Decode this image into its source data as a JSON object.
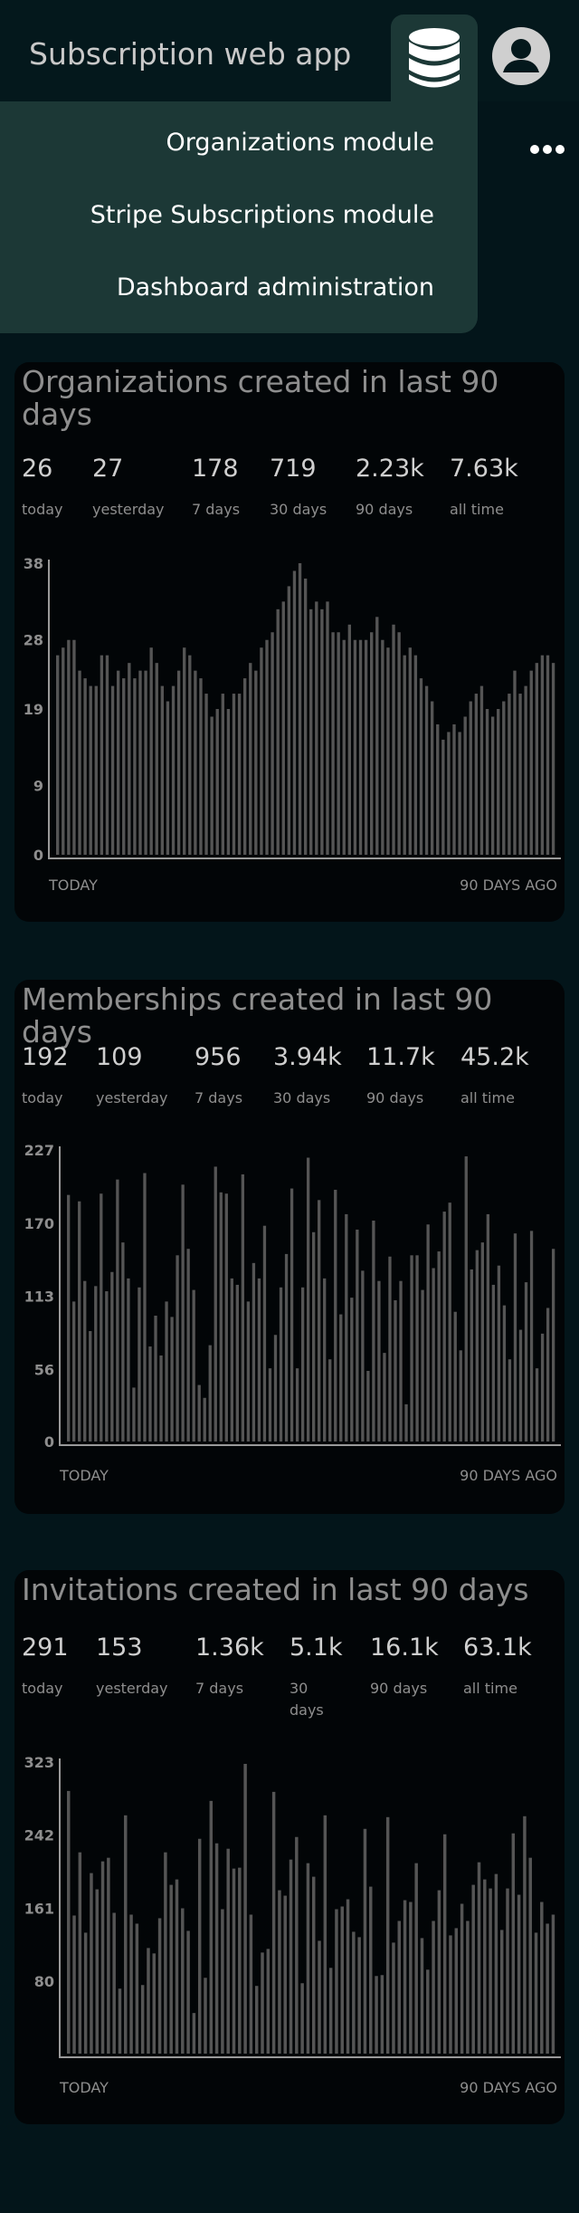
{
  "app": {
    "title": "Subscription web app",
    "accent_panel_color": "#1c3836",
    "background_color": "#03151a",
    "bar_color": "#555555",
    "icons": [
      "database-icon",
      "user-avatar-icon",
      "more-horizontal-icon"
    ]
  },
  "menu": {
    "items": [
      {
        "label": "Organizations module"
      },
      {
        "label": "Stripe Subscriptions module"
      },
      {
        "label": "Dashboard administration"
      }
    ]
  },
  "cards": [
    {
      "title": "Organizations created in last 90 days",
      "stats": [
        {
          "value": "26",
          "label": "today"
        },
        {
          "value": "27",
          "label": "yesterday"
        },
        {
          "value": "178",
          "label": "7 days"
        },
        {
          "value": "719",
          "label": "30 days"
        },
        {
          "value": "2.23k",
          "label": "90 days"
        },
        {
          "value": "7.63k",
          "label": "all time"
        }
      ],
      "x_left_label": "TODAY",
      "x_right_label": "90 DAYS AGO"
    },
    {
      "title": "Memberships created in last 90 days",
      "stats": [
        {
          "value": "192",
          "label": "today"
        },
        {
          "value": "109",
          "label": "yesterday"
        },
        {
          "value": "956",
          "label": "7 days"
        },
        {
          "value": "3.94k",
          "label": "30 days"
        },
        {
          "value": "11.7k",
          "label": "90 days"
        },
        {
          "value": "45.2k",
          "label": "all time"
        }
      ],
      "x_left_label": "TODAY",
      "x_right_label": "90 DAYS AGO"
    },
    {
      "title": "Invitations created in last 90 days",
      "stats": [
        {
          "value": "291",
          "label": "today"
        },
        {
          "value": "153",
          "label": "yesterday"
        },
        {
          "value": "1.36k",
          "label": "7 days"
        },
        {
          "value": "5.1k",
          "label": "30 days"
        },
        {
          "value": "16.1k",
          "label": "90 days"
        },
        {
          "value": "63.1k",
          "label": "all time"
        }
      ],
      "x_left_label": "TODAY",
      "x_right_label": "90 DAYS AGO"
    }
  ],
  "chart_data": [
    {
      "type": "bar",
      "ticks": [
        "38",
        "28",
        "19",
        "9",
        "0"
      ],
      "ylim": [
        0,
        38
      ],
      "grid": false,
      "values": [
        26,
        27,
        28,
        28,
        24,
        23,
        22,
        22,
        26,
        26,
        22,
        24,
        23,
        25,
        23,
        24,
        24,
        27,
        25,
        22,
        20,
        22,
        24,
        27,
        26,
        24,
        23,
        21,
        18,
        19,
        21,
        19,
        21,
        21,
        23,
        25,
        24,
        27,
        28,
        29,
        32,
        33,
        35,
        37,
        38,
        36,
        32,
        33,
        32,
        33,
        29,
        29,
        28,
        30,
        28,
        28,
        28,
        29,
        31,
        28,
        27,
        30,
        29,
        26,
        27,
        26,
        23,
        22,
        20,
        17,
        15,
        16,
        17,
        16,
        18,
        20,
        21,
        22,
        19,
        18,
        19,
        20,
        21,
        24,
        21,
        22,
        24,
        25,
        26,
        26,
        25
      ]
    },
    {
      "type": "bar",
      "ticks": [
        "227",
        "170",
        "113",
        "56",
        "0"
      ],
      "ylim": [
        0,
        227
      ],
      "grid": false,
      "values": [
        192,
        109,
        187,
        125,
        86,
        121,
        193,
        117,
        132,
        204,
        155,
        127,
        42,
        120,
        209,
        74,
        98,
        67,
        109,
        97,
        145,
        200,
        150,
        118,
        44,
        34,
        75,
        214,
        194,
        193,
        127,
        122,
        208,
        109,
        139,
        127,
        168,
        57,
        83,
        120,
        146,
        197,
        57,
        120,
        221,
        163,
        188,
        127,
        64,
        196,
        99,
        177,
        112,
        165,
        133,
        55,
        172,
        125,
        69,
        144,
        110,
        125,
        29,
        145,
        145,
        118,
        169,
        135,
        148,
        179,
        186,
        101,
        71,
        222,
        134,
        149,
        155,
        177,
        122,
        137,
        106,
        64,
        162,
        87,
        124,
        164,
        57,
        84,
        104,
        150
      ]
    },
    {
      "type": "bar",
      "ticks": [
        "323",
        "242",
        "161",
        "80"
      ],
      "ylim": [
        0,
        323
      ],
      "grid": false,
      "values": [
        291,
        153,
        223,
        134,
        200,
        182,
        213,
        217,
        156,
        72,
        264,
        154,
        144,
        76,
        117,
        111,
        150,
        223,
        187,
        193,
        161,
        136,
        45,
        238,
        84,
        280,
        233,
        160,
        227,
        205,
        206,
        321,
        154,
        75,
        112,
        116,
        290,
        181,
        175,
        215,
        240,
        78,
        211,
        196,
        125,
        264,
        95,
        160,
        163,
        171,
        135,
        129,
        249,
        185,
        86,
        87,
        262,
        123,
        147,
        170,
        168,
        211,
        128,
        93,
        147,
        181,
        243,
        131,
        139,
        166,
        147,
        187,
        212,
        193,
        183,
        199,
        137,
        183,
        244,
        176,
        263,
        217,
        134,
        168,
        144,
        154
      ]
    }
  ]
}
